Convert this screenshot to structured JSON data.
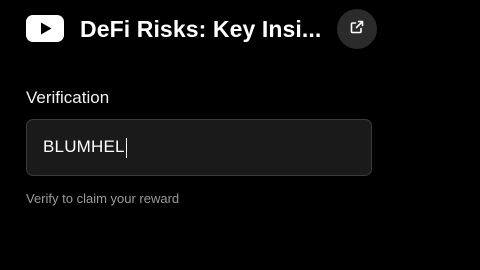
{
  "header": {
    "logo_icon": "youtube-logo-icon",
    "title": "DeFi Risks: Key Insi...",
    "share_icon": "external-link-icon"
  },
  "form": {
    "label": "Verification",
    "input_value": "BLUMHEL",
    "helper_text": "Verify to claim your reward"
  },
  "colors": {
    "background": "#000000",
    "youtube_red": "#ffffff",
    "input_bg": "#1a1a1a",
    "input_border": "#3a3a3a",
    "helper_text": "#9a9a9a"
  }
}
